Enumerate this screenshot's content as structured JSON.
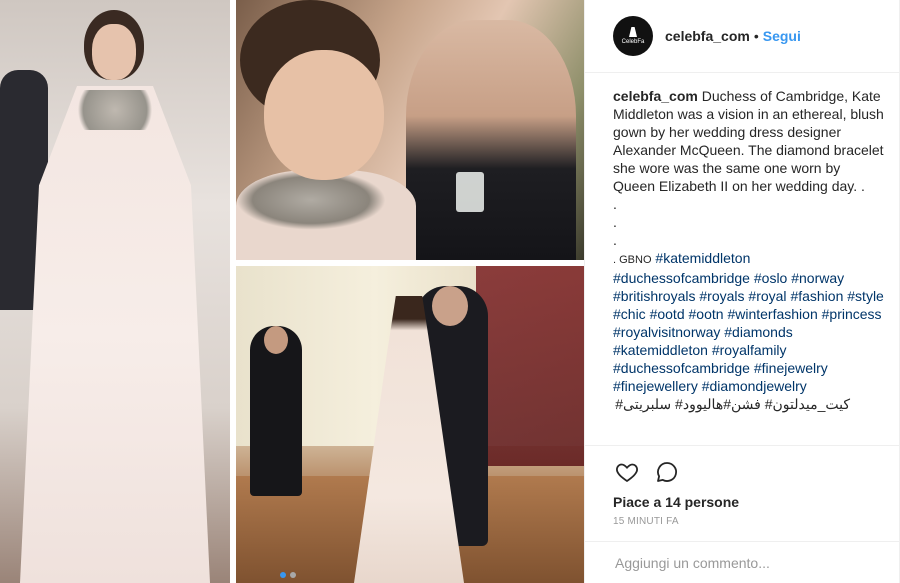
{
  "header": {
    "avatar_text": "CelebFa",
    "username": "celebfa_com",
    "separator": "•",
    "follow_label": "Segui"
  },
  "caption": {
    "username": "celebfa_com",
    "text": "Duchess of Cambridge, Kate Middleton was a vision in an ethereal, blush gown by her wedding dress designer Alexander McQueen. The diamond bracelet she wore was the same one worn by Queen Elizabeth II on her wedding day. .",
    "dot_lines": [
      ".",
      ".",
      "."
    ],
    "gbno": ". GBNO",
    "hashtags": [
      "#katemiddleton",
      "#duchessofcambridge",
      "#oslo",
      "#norway",
      "#britishroyals",
      "#royals",
      "#royal",
      "#fashion",
      "#style",
      "#chic",
      "#ootd",
      "#ootn",
      "#winterfashion",
      "#princess",
      "#royalvisitnorway",
      "#diamonds",
      "#katemiddleton",
      "#royalfamily",
      "#duchessofcambridge",
      "#finejewelry",
      "#finejewellery",
      "#diamondjewelry"
    ],
    "arabic_line": "کیت_میدلتون#  فشن#هالیوود#  سلبریتی#"
  },
  "actions": {
    "like_icon": "heart-outline-icon",
    "comment_icon": "speech-bubble-icon",
    "likes_text": "Piace a 14 persone",
    "time_text": "15 MINUTI FA"
  },
  "comment": {
    "placeholder": "Aggiungi un commento..."
  },
  "carousel": {
    "current_index": 1,
    "total": 2
  },
  "colors": {
    "link_blue": "#3897f0",
    "hashtag": "#003569",
    "muted": "#999999",
    "border": "#efefef"
  }
}
